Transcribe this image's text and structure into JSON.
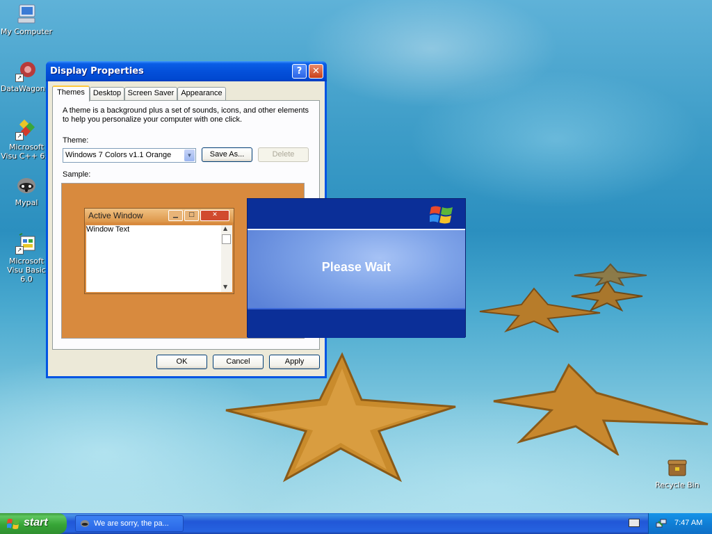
{
  "desktop": {
    "icons": [
      {
        "label": "My Computer"
      },
      {
        "label": "DataWagon..."
      },
      {
        "label": "Microsoft Visu C++ 6.0"
      },
      {
        "label": "Mypal"
      },
      {
        "label": "Microsoft Visu Basic 6.0"
      },
      {
        "label": "Recycle Bin"
      }
    ]
  },
  "display_properties": {
    "title": "Display Properties",
    "help_label": "?",
    "close_label": "✕",
    "tabs": [
      {
        "label": "Themes"
      },
      {
        "label": "Desktop"
      },
      {
        "label": "Screen Saver"
      },
      {
        "label": "Appearance"
      }
    ],
    "description": "A theme is a background plus a set of sounds, icons, and other elements to help you personalize your computer with one click.",
    "theme_label": "Theme:",
    "theme_value": "Windows 7 Colors v1.1 Orange",
    "save_as_label": "Save As...",
    "delete_label": "Delete",
    "sample_label": "Sample:",
    "sample_window_title": "Active Window",
    "sample_window_text": "Window Text",
    "ok_label": "OK",
    "cancel_label": "Cancel",
    "apply_label": "Apply"
  },
  "please_wait": {
    "message": "Please Wait"
  },
  "taskbar": {
    "start_label": "start",
    "task_item_label": "We are sorry, the pa...",
    "clock": "7:47 AM"
  }
}
